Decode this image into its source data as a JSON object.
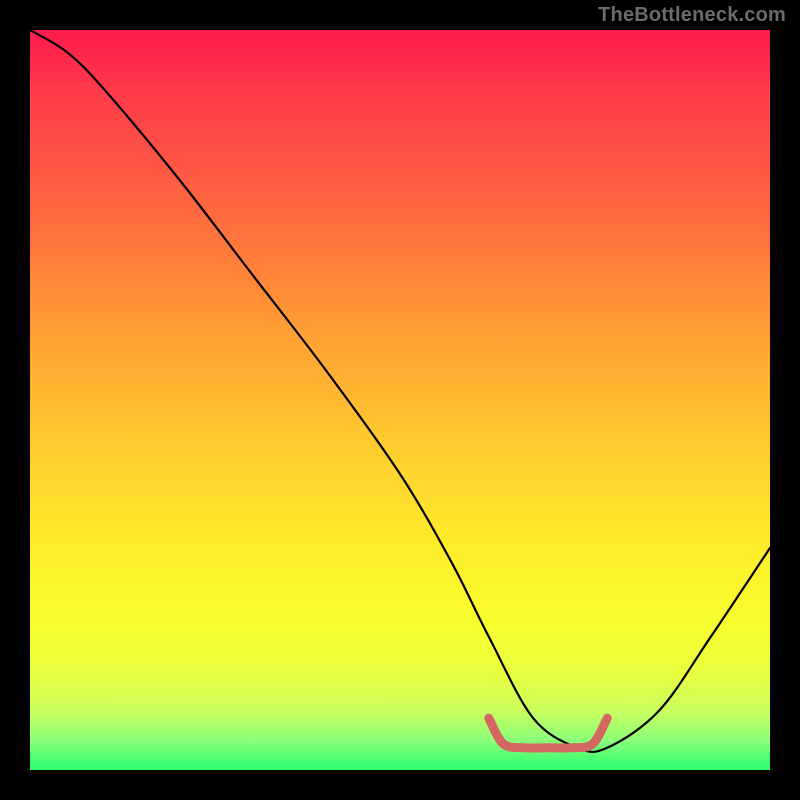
{
  "watermark": "TheBottleneck.com",
  "chart_data": {
    "type": "line",
    "title": "",
    "xlabel": "",
    "ylabel": "",
    "xlim": [
      0,
      100
    ],
    "ylim": [
      0,
      100
    ],
    "grid": false,
    "series": [
      {
        "name": "bottleneck-curve",
        "color": "#000000",
        "x": [
          0,
          5,
          10,
          20,
          30,
          40,
          50,
          57,
          62,
          68,
          74,
          78,
          85,
          92,
          100
        ],
        "values": [
          100,
          97,
          92,
          80,
          67,
          54,
          40,
          28,
          18,
          7,
          3,
          3,
          8,
          18,
          30
        ]
      },
      {
        "name": "optimal-band-marker",
        "color": "#d4675f",
        "x": [
          62,
          64,
          67,
          70,
          73,
          76,
          78
        ],
        "values": [
          7,
          3.5,
          3,
          3,
          3,
          3.5,
          7
        ]
      }
    ],
    "annotations": []
  }
}
